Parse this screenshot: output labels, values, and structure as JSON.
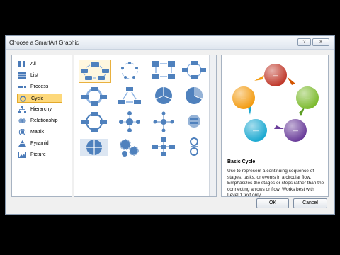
{
  "dialog": {
    "title": "Choose a SmartArt Graphic",
    "help_label": "?",
    "close_label": "x"
  },
  "categories": [
    {
      "label": "All",
      "icon": "all-icon"
    },
    {
      "label": "List",
      "icon": "list-icon"
    },
    {
      "label": "Process",
      "icon": "process-icon"
    },
    {
      "label": "Cycle",
      "icon": "cycle-icon"
    },
    {
      "label": "Hierarchy",
      "icon": "hierarchy-icon"
    },
    {
      "label": "Relationship",
      "icon": "relationship-icon"
    },
    {
      "label": "Matrix",
      "icon": "matrix-icon"
    },
    {
      "label": "Pyramid",
      "icon": "pyramid-icon"
    },
    {
      "label": "Picture",
      "icon": "picture-icon"
    }
  ],
  "selected_category": "Cycle",
  "preview": {
    "title": "Basic Cycle",
    "description": "Use to represent a continuing sequence of stages, tasks, or events in a circular flow. Emphasizes the stages or steps rather than the connecting arrows or flow. Works best with Level 1 text only.",
    "circle_text": "—",
    "colors": [
      "#c0392b",
      "#7dbb2f",
      "#6a3d9a",
      "#1ca9d1",
      "#f39c12"
    ]
  },
  "buttons": {
    "ok": "OK",
    "cancel": "Cancel"
  }
}
